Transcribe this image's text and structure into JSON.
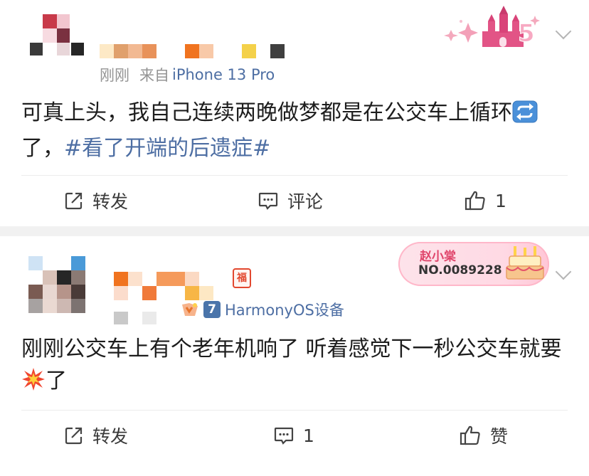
{
  "posts": [
    {
      "time": "刚刚",
      "source_prefix": "来自",
      "source": "iPhone 13 Pro",
      "content_text": "可真上头，我自己连续两晚做梦都是在公交车上循环",
      "content_after_emoji": "了，",
      "topic": "#看了开端的后遗症#",
      "emoji_icon": "repeat-emoji-icon",
      "badge_icon": "castle-anniversary-badge-icon",
      "badge_number": "5",
      "actions": {
        "repost": "转发",
        "comment": "评论",
        "like": "1"
      }
    },
    {
      "device_level": "7",
      "device": "HarmonyOS设备",
      "fortune_char": "福",
      "content_text": "刚刚公交车上有个老年机响了 听着感觉下一秒公交车就要",
      "content_after_emoji": "了",
      "emoji_icon": "collision-emoji-icon",
      "badge_name": "赵小棠",
      "badge_no": "NO.0089228",
      "badge_icon": "birthday-cake-icon",
      "actions": {
        "repost": "转发",
        "comment": "1",
        "like": "赞"
      }
    }
  ],
  "colors": {
    "link": "#4d6ea3",
    "meta": "#939393",
    "badge_pink": "#e0466c"
  }
}
